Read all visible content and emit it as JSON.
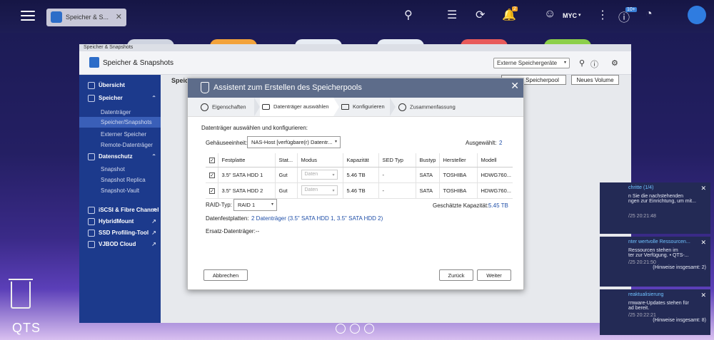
{
  "topbar": {
    "tab_label": "Speicher & S...",
    "tab_close": "✕",
    "notification_badge": "2",
    "user_name": "MYC",
    "update_badge": "10+"
  },
  "window": {
    "small_title": "Speicher & Snapshots",
    "title": "Speicher & Snapshots",
    "external_devices": "Externe Speichergeräte",
    "content_heading": "Speicher",
    "new_pool_btn": "Neuer Speicherpool",
    "new_volume_btn": "Neues Volume"
  },
  "sidebar": {
    "overview": "Übersicht",
    "storage": "Speicher",
    "storage_items": [
      "Datenträger",
      "Speicher/Snapshots",
      "Externer Speicher",
      "Remote-Datenträger"
    ],
    "protection": "Datenschutz",
    "protection_items": [
      "Snapshot",
      "Snapshot Replica",
      "Snapshot-Vault"
    ],
    "links": [
      "iSCSI & Fibre Channel",
      "HybridMount",
      "SSD Profiling-Tool",
      "VJBOD Cloud"
    ]
  },
  "dialog": {
    "title": "Assistent zum Erstellen des Speicherpools",
    "steps": [
      "Eigenschaften",
      "Datenträger auswählen",
      "Konfigurieren",
      "Zusammenfassung"
    ],
    "section_label": "Datenträger auswählen und konfigurieren:",
    "enclosure_label": "Gehäuseeinheit:",
    "enclosure_value": "NAS-Host [verfügbare(r) Datentr...",
    "selected_label": "Ausgewählt:",
    "selected_value": "2",
    "columns": [
      "Festplatte",
      "Stat...",
      "Modus",
      "Kapazität",
      "SED Typ",
      "Bustyp",
      "Hersteller",
      "Modell"
    ],
    "rows": [
      {
        "disk": "3.5\" SATA HDD 1",
        "status": "Gut",
        "mode": "Daten",
        "capacity": "5.46 TB",
        "sed": "-",
        "bus": "SATA",
        "vendor": "TOSHIBA",
        "model": "HDWG760..."
      },
      {
        "disk": "3.5\" SATA HDD 2",
        "status": "Gut",
        "mode": "Daten",
        "capacity": "5.46 TB",
        "sed": "-",
        "bus": "SATA",
        "vendor": "TOSHIBA",
        "model": "HDWG760..."
      }
    ],
    "raid_label": "RAID-Typ:",
    "raid_value": "RAID 1",
    "capacity_label": "Geschätzte Kapazität:",
    "capacity_value": "5.45 TB",
    "data_disks_label": "Datenfestplatten:",
    "data_disks_value": "2 Datenträger (3.5\" SATA HDD 1, 3.5\" SATA HDD 2)",
    "spare_label": "Ersatz-Datenträger:",
    "spare_value": "--",
    "cancel": "Abbrechen",
    "back": "Zurück",
    "next": "Weiter"
  },
  "notifications": [
    {
      "title": "chritte (1/4)",
      "body": "n Sie die nachstehenden\nngen zur Einrichtung, um mit...",
      "time": "/25 20:21:48",
      "extra": ""
    },
    {
      "title": "nter wertvolle Ressourcen...",
      "body": "Ressourcen stehen im\nter zur Verfügung. • QTS-...",
      "time": "/25 20:21:50",
      "extra": "(Hinweise insgesamt: 2)"
    },
    {
      "title": "reaktualisierung",
      "body": "rmware-Updates stehen für\nad bereit.",
      "time": "/25 20:22:21",
      "extra": "(Hinweise insgesamt: 8)"
    }
  ],
  "desktop": {
    "qts_label": "QTS"
  }
}
